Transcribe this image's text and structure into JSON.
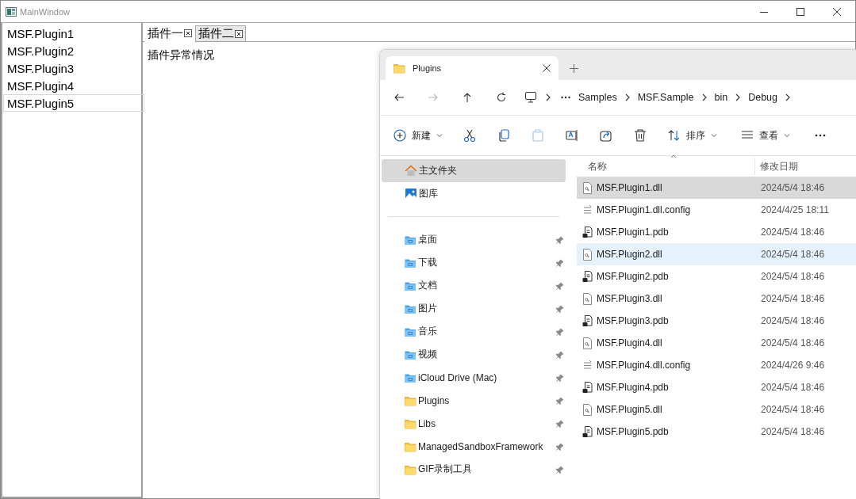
{
  "window": {
    "title": "MainWindow"
  },
  "plugin_list": [
    {
      "label": "MSF.Plugin1",
      "selected": false
    },
    {
      "label": "MSF.Plugin2",
      "selected": false
    },
    {
      "label": "MSF.Plugin3",
      "selected": false
    },
    {
      "label": "MSF.Plugin4",
      "selected": false
    },
    {
      "label": "MSF.Plugin5",
      "selected": true
    }
  ],
  "tabs": [
    {
      "label": "插件一",
      "selected": true
    },
    {
      "label": "插件二",
      "selected": false
    }
  ],
  "tab_content": "插件异常情况",
  "explorer": {
    "tab_title": "Plugins",
    "nav_buttons": [
      {
        "kind": "back",
        "disabled": false
      },
      {
        "kind": "forward",
        "disabled": true
      },
      {
        "kind": "up",
        "disabled": false
      },
      {
        "kind": "refresh",
        "disabled": false
      }
    ],
    "breadcrumb": [
      "Samples",
      "MSF.Sample",
      "bin",
      "Debug"
    ],
    "toolbar": [
      {
        "kind": "new",
        "label": "新建",
        "disabled": false
      },
      {
        "kind": "cut",
        "disabled": false
      },
      {
        "kind": "copy",
        "disabled": false
      },
      {
        "kind": "paste",
        "disabled": true
      },
      {
        "kind": "rename",
        "disabled": false
      },
      {
        "kind": "share",
        "disabled": false
      },
      {
        "kind": "delete",
        "disabled": false
      },
      {
        "kind": "sort",
        "label": "排序",
        "disabled": false
      },
      {
        "kind": "view",
        "label": "查看",
        "disabled": false
      },
      {
        "kind": "more",
        "disabled": false
      }
    ],
    "nav_top": [
      {
        "kind": "home",
        "label": "主文件夹",
        "selected": true
      },
      {
        "kind": "gallery",
        "label": "图库",
        "selected": false
      }
    ],
    "nav_pinned": [
      {
        "kind": "system",
        "label": "桌面"
      },
      {
        "kind": "system",
        "label": "下载"
      },
      {
        "kind": "system",
        "label": "文档"
      },
      {
        "kind": "system",
        "label": "图片"
      },
      {
        "kind": "system",
        "label": "音乐"
      },
      {
        "kind": "system",
        "label": "视频"
      },
      {
        "kind": "system",
        "label": "iCloud Drive (Mac)"
      },
      {
        "kind": "folder",
        "label": "Plugins"
      },
      {
        "kind": "folder",
        "label": "Libs"
      },
      {
        "kind": "folder",
        "label": "ManagedSandboxFramework"
      },
      {
        "kind": "folder",
        "label": "GIF录制工具"
      }
    ],
    "columns": [
      "名称",
      "修改日期"
    ],
    "files": [
      {
        "kind": "dll",
        "name": "MSF.Plugin1.dll",
        "modified": "2024/5/4 18:46",
        "selected": true,
        "hovered": false
      },
      {
        "kind": "config",
        "name": "MSF.Plugin1.dll.config",
        "modified": "2024/4/25 18:11",
        "selected": false,
        "hovered": false
      },
      {
        "kind": "pdb",
        "name": "MSF.Plugin1.pdb",
        "modified": "2024/5/4 18:46",
        "selected": false,
        "hovered": false
      },
      {
        "kind": "dll",
        "name": "MSF.Plugin2.dll",
        "modified": "2024/5/4 18:46",
        "selected": false,
        "hovered": true
      },
      {
        "kind": "pdb",
        "name": "MSF.Plugin2.pdb",
        "modified": "2024/5/4 18:46",
        "selected": false,
        "hovered": false
      },
      {
        "kind": "dll",
        "name": "MSF.Plugin3.dll",
        "modified": "2024/5/4 18:46",
        "selected": false,
        "hovered": false
      },
      {
        "kind": "pdb",
        "name": "MSF.Plugin3.pdb",
        "modified": "2024/5/4 18:46",
        "selected": false,
        "hovered": false
      },
      {
        "kind": "dll",
        "name": "MSF.Plugin4.dll",
        "modified": "2024/5/4 18:46",
        "selected": false,
        "hovered": false
      },
      {
        "kind": "config",
        "name": "MSF.Plugin4.dll.config",
        "modified": "2024/4/26 9:46",
        "selected": false,
        "hovered": false
      },
      {
        "kind": "pdb",
        "name": "MSF.Plugin4.pdb",
        "modified": "2024/5/4 18:46",
        "selected": false,
        "hovered": false
      },
      {
        "kind": "dll",
        "name": "MSF.Plugin5.dll",
        "modified": "2024/5/4 18:46",
        "selected": false,
        "hovered": false
      },
      {
        "kind": "pdb",
        "name": "MSF.Plugin5.pdb",
        "modified": "2024/5/4 18:46",
        "selected": false,
        "hovered": false
      }
    ]
  }
}
